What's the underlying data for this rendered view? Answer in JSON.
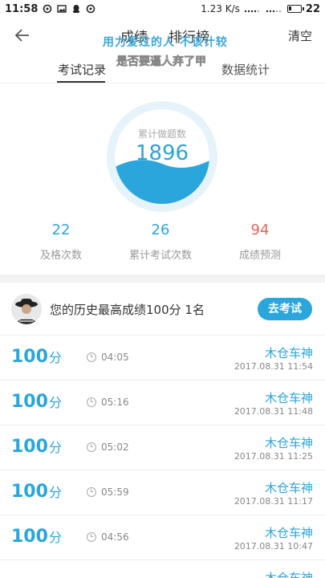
{
  "status": {
    "time": "11:58",
    "speed": "1.23 K/s",
    "battery": "22",
    "battery_level": 0.22
  },
  "header": {
    "tabs": [
      "成绩",
      "排行榜"
    ],
    "clear_label": "清空",
    "overlay_line1": "用力爱过的人 不该计较",
    "overlay_line2": "是否要逼人弃了甲"
  },
  "subtabs": {
    "exam_records": "考试记录",
    "data_stats": "数据统计"
  },
  "summary": {
    "total_label": "累计做题数",
    "total_value": "1896",
    "stats": [
      {
        "value": "22",
        "label": "及格次数",
        "color": "#2aa6dc"
      },
      {
        "value": "26",
        "label": "累计考试次数",
        "color": "#2aa6dc"
      },
      {
        "value": "94",
        "label": "成绩预测",
        "color": "#e0675a"
      }
    ]
  },
  "best": {
    "text": "您的历史最高成绩100分 1名",
    "button": "去考试"
  },
  "records": [
    {
      "score": "100",
      "unit": "分",
      "duration": "04:05",
      "name": "木仓车神",
      "date": "2017.08.31  11:54"
    },
    {
      "score": "100",
      "unit": "分",
      "duration": "05:16",
      "name": "木仓车神",
      "date": "2017.08.31  11:48"
    },
    {
      "score": "100",
      "unit": "分",
      "duration": "05:02",
      "name": "木仓车神",
      "date": "2017.08.31  11:25"
    },
    {
      "score": "100",
      "unit": "分",
      "duration": "05:59",
      "name": "木仓车神",
      "date": "2017.08.31  11:17"
    },
    {
      "score": "100",
      "unit": "分",
      "duration": "04:56",
      "name": "木仓车神",
      "date": "2017.08.31  10:47"
    },
    {
      "score": "",
      "unit": "",
      "duration": "",
      "name": "木仓车神",
      "date": ""
    }
  ]
}
